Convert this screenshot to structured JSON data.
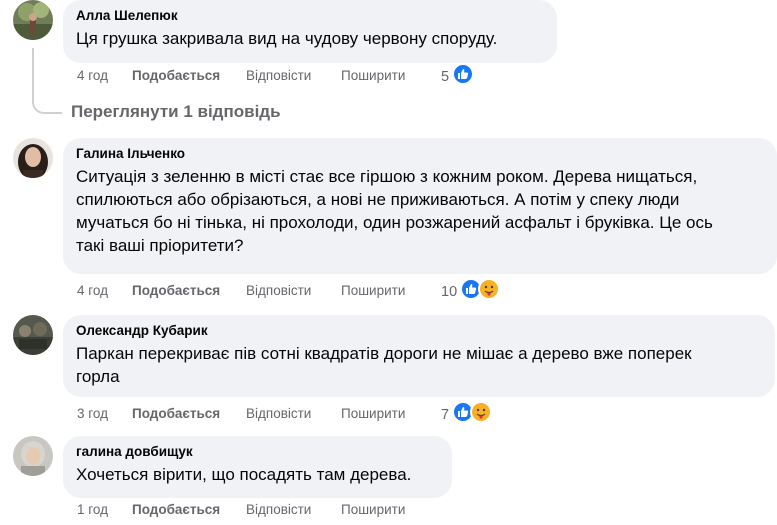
{
  "comments": [
    {
      "author": "Алла Шелепюк",
      "lines": [
        "Ця грушка закривала вид на чудову червону споруду."
      ],
      "time": "4 год",
      "like_label": "Подобається",
      "reply_label": "Відповісти",
      "share_label": "Поширити",
      "reaction_count": "5",
      "reactions": [
        "like-icon"
      ]
    },
    {
      "author": "Галина Ільченко",
      "lines": [
        "Ситуація з зеленню в місті стає все гіршою з кожним роком. Дерева нищаться,",
        "спилюються або обрізаються, а нові не приживаються. А потім у спеку люди",
        "мучаться бо ні тінька, ні прохолоди, один розжарений асфальт і бруківка. Це ось",
        "такі ваші пріоритети?"
      ],
      "time": "4 год",
      "like_label": "Подобається",
      "reply_label": "Відповісти",
      "share_label": "Поширити",
      "reaction_count": "10",
      "reactions": [
        "like-icon",
        "hug-emoji-icon"
      ]
    },
    {
      "author": "Олександр Кубарик",
      "lines": [
        "Паркан перекриває пів сотні квадратів дороги не мішає а дерево вже поперек",
        "горла"
      ],
      "time": "3 год",
      "like_label": "Подобається",
      "reply_label": "Відповісти",
      "share_label": "Поширити",
      "reaction_count": "7",
      "reactions": [
        "like-icon",
        "hug-emoji-icon"
      ]
    },
    {
      "author": "галина довбищук",
      "lines": [
        "Хочеться вірити, що посадять там дерева."
      ],
      "time": "1 год",
      "like_label": "Подобається",
      "reply_label": "Відповісти",
      "share_label": "Поширити",
      "reaction_count": "",
      "reactions": []
    }
  ],
  "view_replies": "Переглянути 1 відповідь",
  "colors": {
    "bubble": "#f0f2f5",
    "meta_text": "#65676b",
    "like_blue": "#1877f2",
    "hug_yellow": "#f7b125"
  }
}
